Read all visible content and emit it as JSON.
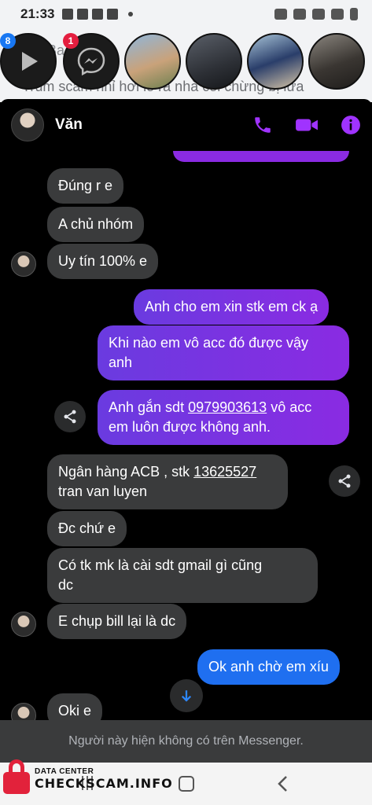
{
  "status_bar": {
    "time": "21:33"
  },
  "background_app": {
    "line1": "Trùm scam nhỉ hơi lo ra nhà coi chừng bị lừa",
    "line2": "Ba"
  },
  "chat_heads": [
    {
      "name": "play-head",
      "badge": "8"
    },
    {
      "name": "messenger-head",
      "badge": "1"
    }
  ],
  "conversation": {
    "contact_name": "Văn",
    "messages": [
      {
        "from": "them",
        "text": "Đúng r e"
      },
      {
        "from": "them",
        "text": "A chủ nhóm"
      },
      {
        "from": "them",
        "text": "Uy tín 100% e"
      },
      {
        "from": "me",
        "text": "Anh cho em xin stk em ck ạ"
      },
      {
        "from": "me",
        "text_line1": "Khi nào em vô acc đó được vậy",
        "text_line2": "anh"
      },
      {
        "from": "me",
        "text_pre": "Anh gắn sdt ",
        "phone": "0979903613",
        "text_post": " vô acc",
        "text_line2": "em luôn được không anh."
      },
      {
        "from": "them",
        "text_pre": "Ngân hàng ACB , stk ",
        "account": "13625527",
        "text_line2": "tran van luyen"
      },
      {
        "from": "them",
        "text": "Đc chứ e"
      },
      {
        "from": "them",
        "text_line1": "Có tk mk là cài sdt gmail gì cũng",
        "text_line2": "dc"
      },
      {
        "from": "them",
        "text": "E chụp bill lại là dc"
      },
      {
        "from": "me",
        "text": "Ok anh chờ em xíu"
      },
      {
        "from": "them",
        "text": "Oki e"
      }
    ]
  },
  "footer_note": "Người này hiện không có trên Messenger.",
  "watermark": {
    "small": "DATA CENTER",
    "big": "CHECKSCAM.INFO"
  },
  "colors": {
    "accent": "#8a2be2",
    "blue_bubble": "#1f6ff0",
    "incoming": "#3a3b3c",
    "watermark_red": "#e2223b"
  }
}
